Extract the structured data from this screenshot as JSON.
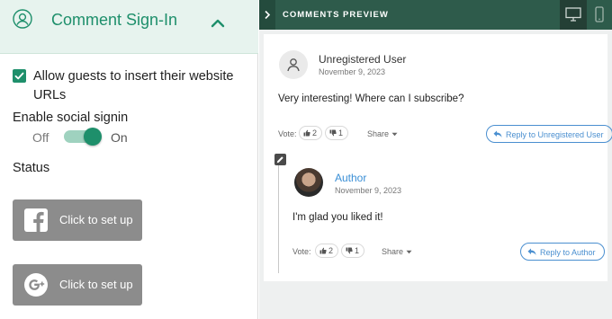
{
  "settings": {
    "section_title": "Comment Sign-In",
    "allow_website_label": "Allow guests to insert their website URLs",
    "allow_website_checked": true,
    "social_signin_label": "Enable social signin",
    "toggle_off_label": "Off",
    "toggle_on_label": "On",
    "social_signin_enabled": true,
    "status_label": "Status",
    "facebook_button_label": "Click to set up",
    "google_button_label": "Click to set up"
  },
  "preview": {
    "heading": "COMMENTS PREVIEW",
    "comments": [
      {
        "author": "Unregistered User",
        "date": "November 9, 2023",
        "text": "Very interesting! Where can I subscribe?",
        "vote_label": "Vote:",
        "upvotes": "2",
        "downvotes": "1",
        "share_label": "Share",
        "reply_label": "Reply to Unregistered User"
      },
      {
        "author": "Author",
        "date": "November 9, 2023",
        "text": "I'm glad you liked it!",
        "vote_label": "Vote:",
        "upvotes": "2",
        "downvotes": "1",
        "share_label": "Share",
        "reply_label": "Reply to Author"
      }
    ]
  },
  "colors": {
    "accent": "#1e8f6b",
    "header_bg": "#2e5b4b",
    "link_blue": "#4a8fd0",
    "button_grey": "#8c8c8c"
  },
  "icons": [
    "user-circle-icon",
    "chevron-up-icon",
    "check-icon",
    "facebook-icon",
    "google-plus-icon",
    "chevron-right-icon",
    "desktop-icon",
    "mobile-icon",
    "user-icon",
    "thumbs-up-icon",
    "thumbs-down-icon",
    "caret-down-icon",
    "reply-icon",
    "pencil-icon"
  ]
}
